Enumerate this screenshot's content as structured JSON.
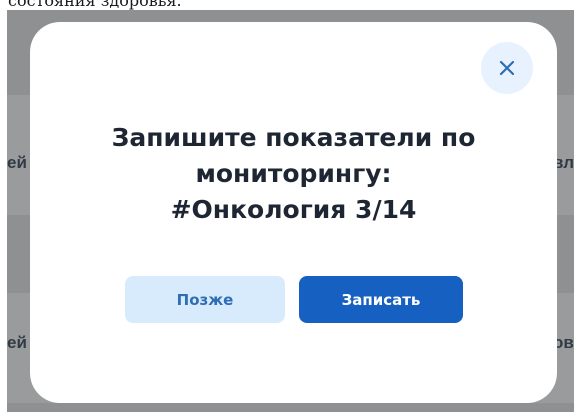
{
  "caption": {
    "text": "состояния здоровья."
  },
  "background": {
    "row1_left": "ей",
    "row1_right": "вл",
    "row2_left": "ей",
    "row2_right": "ов"
  },
  "modal": {
    "close_icon": "close-icon",
    "title_line1": "Запишите показатели по",
    "title_line2": "мониторингу:",
    "title_line3": "#Онкология 3/14",
    "later_label": "Позже",
    "record_label": "Записать"
  },
  "colors": {
    "primary": "#1560c1",
    "secondary_bg": "#d8ebfd",
    "close_bg": "#e8f2fe",
    "title": "#1e2633"
  }
}
